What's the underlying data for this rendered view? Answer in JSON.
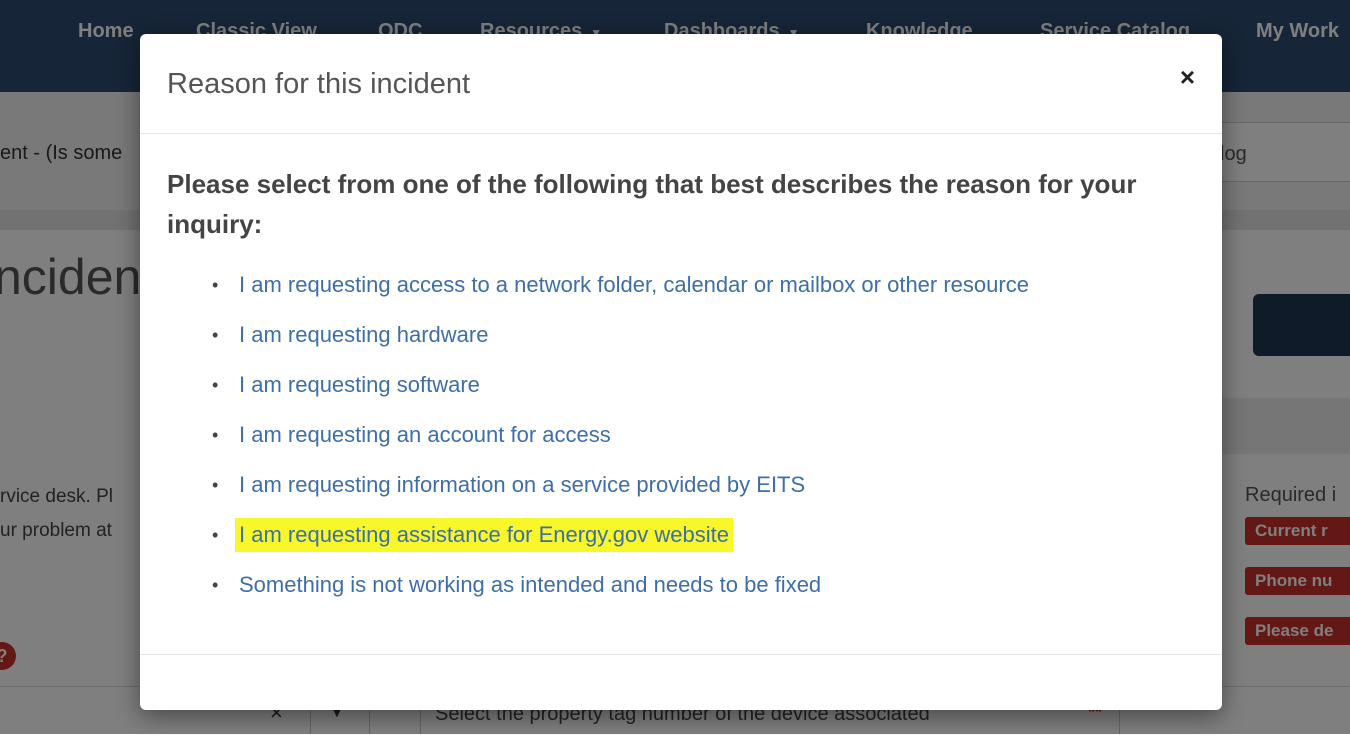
{
  "nav": {
    "items": [
      {
        "label": "Home"
      },
      {
        "label": "Classic View"
      },
      {
        "label": "ODC"
      },
      {
        "label": "Resources"
      },
      {
        "label": "Dashboards"
      },
      {
        "label": "Knowledge"
      },
      {
        "label": "Service Catalog"
      },
      {
        "label": "My Work"
      }
    ],
    "caret_glyph": "▼"
  },
  "background": {
    "breadcrumb": "ent - (Is some",
    "catalog_text": "log",
    "page_title": "ncident",
    "desc_line1": "rvice desk. Pl",
    "desc_line2": "ur problem at",
    "required_label": "Required i",
    "required_badges": [
      "Current r",
      "Phone nu",
      "Please de"
    ],
    "help_icon": "?",
    "select_clear": "×",
    "select_caret": "▼",
    "property_placeholder": "Select the property tag number of the device associated",
    "required_star": "**"
  },
  "modal": {
    "title": "Reason for this incident",
    "close_icon": "×",
    "prompt": "Please select from one of the following that best describes the reason for your inquiry:",
    "bullet_glyph": "•",
    "reasons": [
      {
        "label": "I am requesting access to a network folder, calendar or mailbox or other resource"
      },
      {
        "label": "I am requesting hardware"
      },
      {
        "label": "I am requesting software"
      },
      {
        "label": "I am requesting an account for access"
      },
      {
        "label": "I am requesting information on a service provided by EITS"
      },
      {
        "label": "I am requesting assistance for Energy.gov website",
        "highlighted": true
      },
      {
        "label": "Something is not working as intended and needs to be fixed"
      }
    ]
  },
  "colors": {
    "nav_bg": "#2c4a6e",
    "link": "#3e6ea8",
    "highlight": "#f7f72a",
    "required_badge": "#c9302c"
  }
}
